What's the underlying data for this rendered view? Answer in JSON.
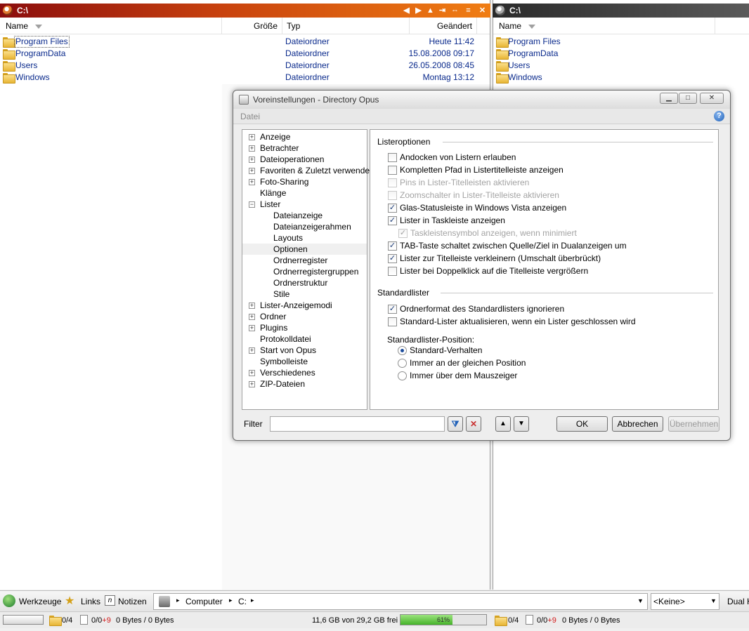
{
  "left": {
    "path": "C:\\",
    "columns": {
      "name": "Name",
      "size": "Größe",
      "type": "Typ",
      "modified": "Geändert"
    },
    "rows": [
      {
        "name": "Program Files",
        "type": "Dateiordner",
        "modified": "Heute 11:42"
      },
      {
        "name": "ProgramData",
        "type": "Dateiordner",
        "modified": "15.08.2008 09:17"
      },
      {
        "name": "Users",
        "type": "Dateiordner",
        "modified": "26.05.2008 08:45"
      },
      {
        "name": "Windows",
        "type": "Dateiordner",
        "modified": "Montag 13:12"
      }
    ]
  },
  "right": {
    "path": "C:\\",
    "columns": {
      "name": "Name"
    },
    "rows": [
      {
        "name": "Program Files"
      },
      {
        "name": "ProgramData"
      },
      {
        "name": "Users"
      },
      {
        "name": "Windows"
      }
    ]
  },
  "dialog": {
    "title": "Voreinstellungen - Directory Opus",
    "menu": "Datei",
    "help": "?",
    "tree": [
      {
        "label": "Anzeige",
        "expander": "+",
        "level": 0
      },
      {
        "label": "Betrachter",
        "expander": "+",
        "level": 0
      },
      {
        "label": "Dateioperationen",
        "expander": "+",
        "level": 0
      },
      {
        "label": "Favoriten & Zuletzt verwendet",
        "expander": "+",
        "level": 0
      },
      {
        "label": "Foto-Sharing",
        "expander": "+",
        "level": 0
      },
      {
        "label": "Klänge",
        "expander": "",
        "level": 0
      },
      {
        "label": "Lister",
        "expander": "−",
        "level": 0
      },
      {
        "label": "Dateianzeige",
        "expander": "",
        "level": 1
      },
      {
        "label": "Dateianzeigerahmen",
        "expander": "",
        "level": 1
      },
      {
        "label": "Layouts",
        "expander": "",
        "level": 1
      },
      {
        "label": "Optionen",
        "expander": "",
        "level": 1,
        "selected": true
      },
      {
        "label": "Ordnerregister",
        "expander": "",
        "level": 1
      },
      {
        "label": "Ordnerregistergruppen",
        "expander": "",
        "level": 1
      },
      {
        "label": "Ordnerstruktur",
        "expander": "",
        "level": 1
      },
      {
        "label": "Stile",
        "expander": "",
        "level": 1
      },
      {
        "label": "Lister-Anzeigemodi",
        "expander": "+",
        "level": 0
      },
      {
        "label": "Ordner",
        "expander": "+",
        "level": 0
      },
      {
        "label": "Plugins",
        "expander": "+",
        "level": 0
      },
      {
        "label": "Protokolldatei",
        "expander": "",
        "level": 0
      },
      {
        "label": "Start von Opus",
        "expander": "+",
        "level": 0
      },
      {
        "label": "Symbolleiste",
        "expander": "",
        "level": 0
      },
      {
        "label": "Verschiedenes",
        "expander": "+",
        "level": 0
      },
      {
        "label": "ZIP-Dateien",
        "expander": "+",
        "level": 0
      }
    ],
    "group1": {
      "title": "Listeroptionen",
      "options": [
        {
          "label": "Andocken von Listern erlauben",
          "checked": false,
          "disabled": false,
          "indent": false
        },
        {
          "label": "Kompletten Pfad in Listertitelleiste anzeigen",
          "checked": false,
          "disabled": false,
          "indent": false
        },
        {
          "label": "Pins in Lister-Titelleisten aktivieren",
          "checked": false,
          "disabled": true,
          "indent": false
        },
        {
          "label": "Zoomschalter in Lister-Titelleiste aktivieren",
          "checked": false,
          "disabled": true,
          "indent": false
        },
        {
          "label": "Glas-Statusleiste in Windows Vista anzeigen",
          "checked": true,
          "disabled": false,
          "indent": false
        },
        {
          "label": "Lister in Taskleiste anzeigen",
          "checked": true,
          "disabled": false,
          "indent": false
        },
        {
          "label": "Taskleistensymbol anzeigen, wenn minimiert",
          "checked": true,
          "disabled": true,
          "indent": true
        },
        {
          "label": "TAB-Taste schaltet zwischen Quelle/Ziel in Dualanzeigen um",
          "checked": true,
          "disabled": false,
          "indent": false
        },
        {
          "label": "Lister zur Titelleiste verkleinern (Umschalt überbrückt)",
          "checked": true,
          "disabled": false,
          "indent": false
        },
        {
          "label": "Lister bei Doppelklick auf die Titelleiste vergrößern",
          "checked": false,
          "disabled": false,
          "indent": false
        }
      ]
    },
    "group2": {
      "title": "Standardlister",
      "options": [
        {
          "label": "Ordnerformat des Standardlisters ignorieren",
          "checked": true
        },
        {
          "label": "Standard-Lister aktualisieren, wenn ein Lister geschlossen wird",
          "checked": false
        }
      ],
      "position_label": "Standardlister-Position:",
      "radios": [
        {
          "label": "Standard-Verhalten",
          "selected": true
        },
        {
          "label": "Immer an der gleichen Position",
          "selected": false
        },
        {
          "label": "Immer über dem Mauszeiger",
          "selected": false
        }
      ]
    },
    "filter_label": "Filter",
    "filter_value": "",
    "ok": "OK",
    "cancel": "Abbrechen",
    "apply": "Übernehmen"
  },
  "toolbar": {
    "tools": "Werkzeuge",
    "links": "Links",
    "notes": "Notizen",
    "breadcrumb": [
      "Computer",
      "C:"
    ],
    "format_select": "<Keine>",
    "dual": "Dual H"
  },
  "status": {
    "left_folders": "0/4",
    "left_files_a": "0/0",
    "left_files_b": "+9",
    "left_bytes": "0 Bytes / 0 Bytes",
    "free": "11,6 GB von 29,2 GB frei",
    "used_percent": 61,
    "used_label": "61%",
    "right_folders": "0/4",
    "right_files_a": "0/0",
    "right_files_b": "+9",
    "right_bytes": "0 Bytes / 0 Bytes"
  },
  "colors": {
    "left_title_accent": "#f07d13",
    "right_title": "#3a3a3a",
    "link_text": "#0a2a8c"
  }
}
